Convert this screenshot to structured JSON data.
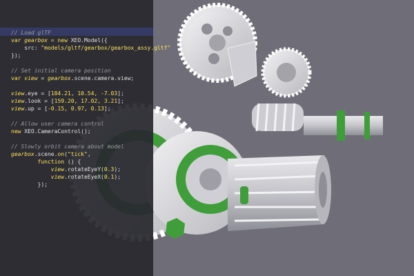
{
  "editor": {
    "lines": [
      {
        "segments": [
          {
            "t": "// Load glTF",
            "c": "cm"
          }
        ]
      },
      {
        "segments": [
          {
            "t": "var ",
            "c": "kw"
          },
          {
            "t": "gearbox",
            "c": "var"
          },
          {
            "t": " = new ",
            "c": "kw"
          },
          {
            "t": "XEO.Model",
            "c": "pl"
          },
          {
            "t": "({",
            "c": "pl"
          }
        ]
      },
      {
        "segments": [
          {
            "t": "    src: ",
            "c": "pl"
          },
          {
            "t": "\"models/gltf/gearbox/gearbox_assy.gltf\"",
            "c": "str"
          }
        ]
      },
      {
        "segments": [
          {
            "t": "});",
            "c": "pl"
          }
        ]
      },
      {
        "segments": []
      },
      {
        "segments": [
          {
            "t": "// Set initial camera position",
            "c": "cm"
          }
        ]
      },
      {
        "segments": [
          {
            "t": "var ",
            "c": "kw"
          },
          {
            "t": "view",
            "c": "var"
          },
          {
            "t": " = ",
            "c": "pl"
          },
          {
            "t": "gearbox",
            "c": "var"
          },
          {
            "t": ".scene.camera.view;",
            "c": "pl"
          }
        ]
      },
      {
        "segments": []
      },
      {
        "segments": [
          {
            "t": "view",
            "c": "var"
          },
          {
            "t": ".eye = [",
            "c": "pl"
          },
          {
            "t": "184.21, 10.54, -7.03",
            "c": "num"
          },
          {
            "t": "];",
            "c": "pl"
          }
        ]
      },
      {
        "segments": [
          {
            "t": "view",
            "c": "var"
          },
          {
            "t": ".look = [",
            "c": "pl"
          },
          {
            "t": "159.20, 17.02, 3.21",
            "c": "num"
          },
          {
            "t": "];",
            "c": "pl"
          }
        ]
      },
      {
        "segments": [
          {
            "t": "view",
            "c": "var"
          },
          {
            "t": ".up = [",
            "c": "pl"
          },
          {
            "t": "-0.15, 0.97, 0.13",
            "c": "num"
          },
          {
            "t": "];",
            "c": "pl"
          }
        ]
      },
      {
        "segments": []
      },
      {
        "segments": [
          {
            "t": "// Allow user camera control",
            "c": "cm"
          }
        ]
      },
      {
        "segments": [
          {
            "t": "new ",
            "c": "kw"
          },
          {
            "t": "XEO.CameraControl",
            "c": "pl"
          },
          {
            "t": "();",
            "c": "pl"
          }
        ]
      },
      {
        "segments": []
      },
      {
        "segments": [
          {
            "t": "// Slowly orbit camera about model",
            "c": "cm"
          }
        ]
      },
      {
        "segments": [
          {
            "t": "gearbox",
            "c": "var"
          },
          {
            "t": ".scene.",
            "c": "pl"
          },
          {
            "t": "on",
            "c": "kw"
          },
          {
            "t": "(",
            "c": "pl"
          },
          {
            "t": "\"tick\"",
            "c": "str"
          },
          {
            "t": ",",
            "c": "pl"
          }
        ]
      },
      {
        "segments": [
          {
            "t": "        ",
            "c": "pl"
          },
          {
            "t": "function",
            "c": "kw"
          },
          {
            "t": " () {",
            "c": "pl"
          }
        ]
      },
      {
        "segments": [
          {
            "t": "            ",
            "c": "pl"
          },
          {
            "t": "view",
            "c": "var"
          },
          {
            "t": ".rotateEyeY(",
            "c": "pl"
          },
          {
            "t": "0.3",
            "c": "num"
          },
          {
            "t": ");",
            "c": "pl"
          }
        ]
      },
      {
        "segments": [
          {
            "t": "            ",
            "c": "pl"
          },
          {
            "t": "view",
            "c": "var"
          },
          {
            "t": ".rotateEyeX(",
            "c": "pl"
          },
          {
            "t": "0.1",
            "c": "num"
          },
          {
            "t": ");",
            "c": "pl"
          }
        ]
      },
      {
        "segments": [
          {
            "t": "        });",
            "c": "pl"
          }
        ]
      }
    ]
  },
  "colors": {
    "background": "#6f6e78",
    "gear": "#d9d8dc",
    "accent_green": "#3f9e3a"
  }
}
